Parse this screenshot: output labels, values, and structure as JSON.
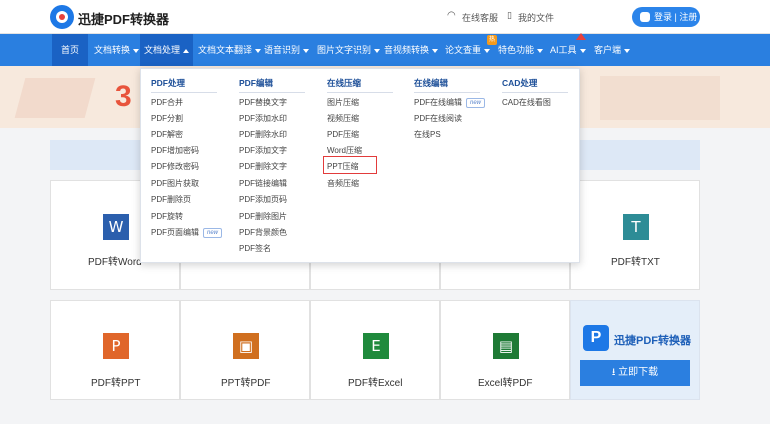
{
  "header": {
    "brand": "迅捷PDF转换器",
    "service_label": "在线客服",
    "docs_label": "我的文件",
    "login_label": "登录 | 注册"
  },
  "nav": {
    "items": [
      {
        "label": "首页"
      },
      {
        "label": "文档转换"
      },
      {
        "label": "文档处理"
      },
      {
        "label": "文档文本翻译"
      },
      {
        "label": "语音识别"
      },
      {
        "label": "图片文字识别"
      },
      {
        "label": "音视频转换"
      },
      {
        "label": "论文查重",
        "badge": "热"
      },
      {
        "label": "特色功能"
      },
      {
        "label": "AI工具"
      },
      {
        "label": "客户端"
      }
    ]
  },
  "banner": {
    "number": "3"
  },
  "dropdown": {
    "columns": [
      {
        "title": "PDF处理",
        "items": [
          {
            "label": "PDF合并"
          },
          {
            "label": "PDF分割"
          },
          {
            "label": "PDF解密"
          },
          {
            "label": "PDF增加密码"
          },
          {
            "label": "PDF修改密码"
          },
          {
            "label": "PDF图片获取"
          },
          {
            "label": "PDF删除页"
          },
          {
            "label": "PDF旋转"
          },
          {
            "label": "PDF页面编辑",
            "tag": "new"
          }
        ]
      },
      {
        "title": "PDF编辑",
        "items": [
          {
            "label": "PDF替换文字"
          },
          {
            "label": "PDF添加水印"
          },
          {
            "label": "PDF删除水印"
          },
          {
            "label": "PDF添加文字"
          },
          {
            "label": "PDF删除文字"
          },
          {
            "label": "PDF链接编辑"
          },
          {
            "label": "PDF添加页码"
          },
          {
            "label": "PDF删除图片"
          },
          {
            "label": "PDF背景颜色"
          },
          {
            "label": "PDF签名"
          }
        ]
      },
      {
        "title": "在线压缩",
        "items": [
          {
            "label": "图片压缩"
          },
          {
            "label": "视频压缩"
          },
          {
            "label": "PDF压缩"
          },
          {
            "label": "Word压缩"
          },
          {
            "label": "PPT压缩"
          },
          {
            "label": "音频压缩"
          }
        ]
      },
      {
        "title": "在线编辑",
        "items": [
          {
            "label": "PDF在线编辑",
            "tag": "new"
          },
          {
            "label": "PDF在线阅读"
          },
          {
            "label": "在线PS"
          }
        ]
      },
      {
        "title": "CAD处理",
        "items": [
          {
            "label": "CAD在线看图"
          }
        ]
      }
    ]
  },
  "cards": [
    {
      "label": "PDF转Word",
      "icon": "W",
      "color": "#2b5fad"
    },
    {
      "label": "PDF转TXT",
      "icon": "T",
      "color": "#2d8c96"
    },
    {
      "label": "PDF转PPT",
      "icon": "P",
      "color": "#e0662a"
    },
    {
      "label": "PPT转PDF",
      "icon": "▣",
      "color": "#d06f1f"
    },
    {
      "label": "PDF转Excel",
      "icon": "E",
      "color": "#1f8a3c"
    },
    {
      "label": "Excel转PDF",
      "icon": "▤",
      "color": "#1e7a35"
    }
  ],
  "promo": {
    "name": "迅捷PDF转换器",
    "logo_letter": "P",
    "button_label": "立即下载"
  },
  "colors": {
    "nav": "#2a7fe0",
    "nav_active": "#1a62c4",
    "accent": "#2b84ea",
    "highlight": "#e23b3b"
  }
}
